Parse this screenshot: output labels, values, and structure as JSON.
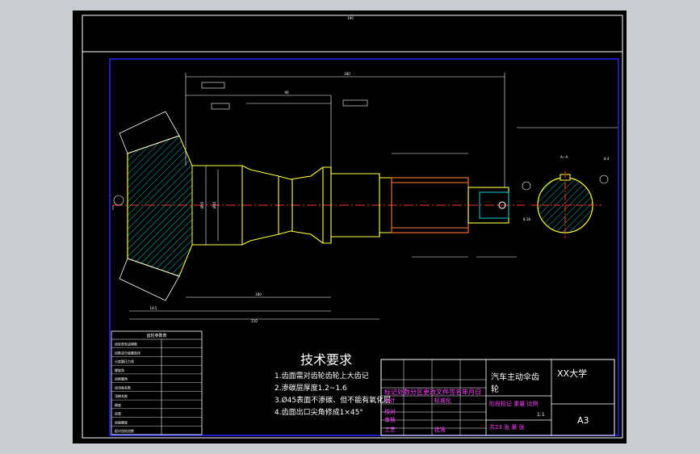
{
  "drawing": {
    "overall_length": "190",
    "dim_top_2": "180",
    "dim_top_3": "90",
    "dim_bottom_1": "180",
    "dim_bottom_2": "210",
    "dim_bottom_3": "18.5",
    "dim_diameter_1": "Ø55",
    "dim_diameter_2": "Ø40",
    "callout_1": "8.4",
    "callout_2": "8.18"
  },
  "technical_requirements": {
    "title": "技术要求",
    "items": [
      "1.齿面需对齿轮齿轮上大齿记",
      "2.渗碳层厚度1.2~1.6",
      "3.Ø45表面不渗碳、但不能有氧化层",
      "4.齿面出口尖角修成1×45°"
    ]
  },
  "gear_table": {
    "title": "齿轮参数表",
    "rows": [
      [
        "齿轮类型或模数",
        ""
      ],
      [
        "齿数或分度圆直径",
        ""
      ],
      [
        "分度圆压力角",
        ""
      ],
      [
        "螺旋角",
        ""
      ],
      [
        "齿根圆角",
        ""
      ],
      [
        "齿顶高系数",
        ""
      ],
      [
        "顶隙系数",
        ""
      ],
      [
        "精度",
        ""
      ],
      [
        "齿宽",
        ""
      ],
      [
        "齿面硬度",
        ""
      ],
      [
        "配对齿轮齿数",
        ""
      ]
    ]
  },
  "title_block": {
    "part_name_1": "汽车主动伞齿",
    "part_name_2": "轮",
    "school": "XX大学",
    "sheet_size": "A3",
    "header_row": "标记处数分区更改文件签名年月日",
    "row_design": "设计",
    "row_std": "标准化",
    "row_check": "校对",
    "row_review": "审核",
    "row_process": "工艺",
    "row_approve": "批准",
    "stage_mark": "阶段标记 重量 比例",
    "scale": "1:1",
    "sheets": "共23 张 第 张"
  },
  "colors": {
    "background": "#000000",
    "frame": "#ffffff",
    "inner_frame": "#2424ff",
    "centerline": "#ff2b2b",
    "part_outline": "#ffff40",
    "hatch": "#00c0c0",
    "dims": "#ffffff",
    "titleblock_magenta": "#ff40ff",
    "window_bg": "#c9cdd2"
  }
}
